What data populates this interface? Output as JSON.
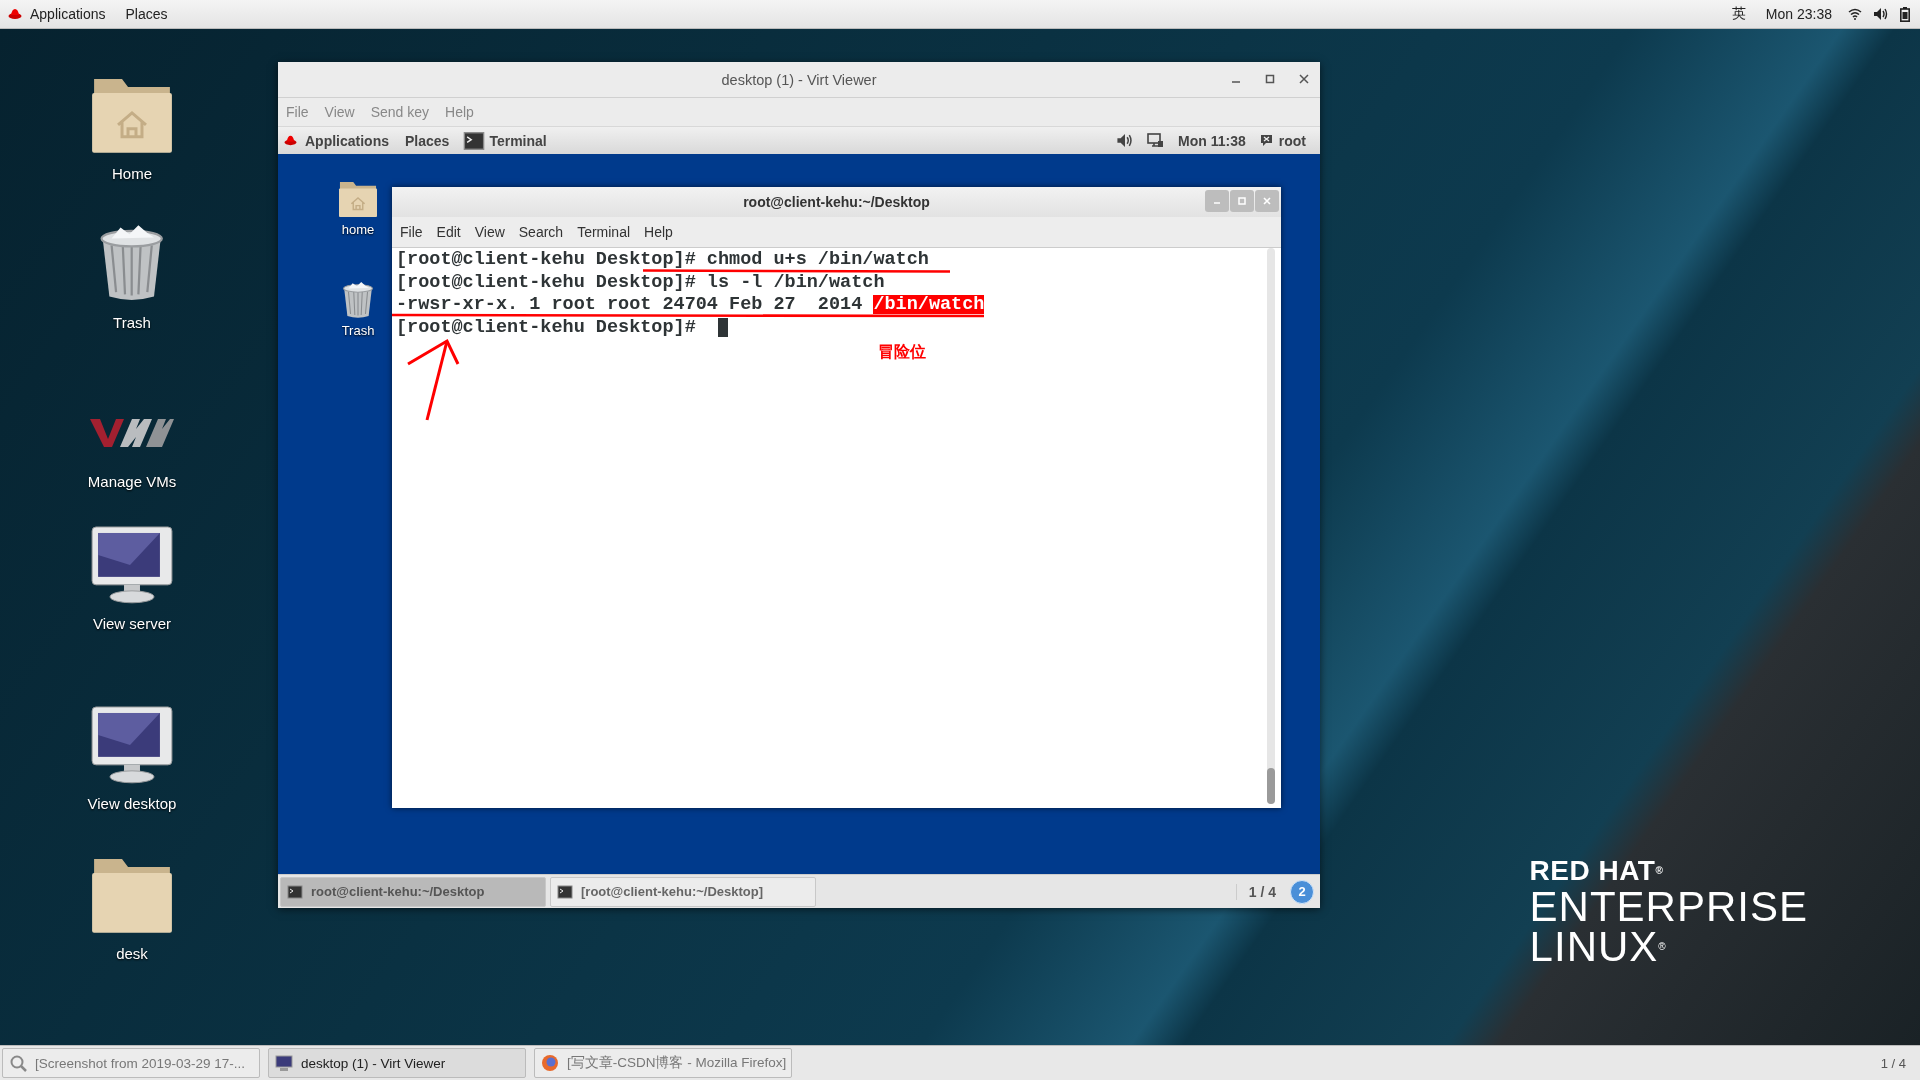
{
  "top_bar": {
    "menus": [
      "Applications",
      "Places"
    ],
    "input_method": "英",
    "clock": "Mon 23:38"
  },
  "desktop_icons": [
    {
      "label": "Home",
      "kind": "home-folder"
    },
    {
      "label": "Trash",
      "kind": "trash"
    },
    {
      "label": "Manage VMs",
      "kind": "vm"
    },
    {
      "label": "View server",
      "kind": "monitor"
    },
    {
      "label": "View desktop",
      "kind": "monitor"
    },
    {
      "label": "desk",
      "kind": "folder"
    }
  ],
  "virt_viewer": {
    "title": "desktop (1) - Virt Viewer",
    "menu": [
      "File",
      "View",
      "Send key",
      "Help"
    ],
    "guest": {
      "top_bar": {
        "menus": [
          "Applications",
          "Places"
        ],
        "active_app": "Terminal",
        "clock": "Mon 11:38",
        "user": "root"
      },
      "desktop_icons": [
        {
          "label": "home",
          "kind": "home-folder"
        },
        {
          "label": "Trash",
          "kind": "trash"
        }
      ],
      "terminal": {
        "title": "root@client-kehu:~/Desktop",
        "menu": [
          "File",
          "Edit",
          "View",
          "Search",
          "Terminal",
          "Help"
        ],
        "lines": [
          [
            {
              "text": "[root@client-kehu Desktop]# chmod u+s /bin/watch",
              "highlighted": false
            }
          ],
          [
            {
              "text": "[root@client-kehu Desktop]# ls -l /bin/watch",
              "highlighted": false
            }
          ],
          [
            {
              "text": "-rwsr-xr-x. 1 root root 24704 Feb 27  2014 ",
              "highlighted": false
            },
            {
              "text": "/bin/watch",
              "highlighted": true
            }
          ],
          [
            {
              "text": "[root@client-kehu Desktop]# ",
              "highlighted": false
            }
          ]
        ],
        "cursor": true,
        "annotation": "冒险位"
      },
      "taskbar": {
        "items": [
          {
            "label": "root@client-kehu:~/Desktop",
            "selected": true
          },
          {
            "label": "[root@client-kehu:~/Desktop]",
            "selected": false
          }
        ],
        "workspace": "1 / 4",
        "badge": "2"
      }
    }
  },
  "wallpaper_brand": {
    "line_1": "RED HAT$^{®}$",
    "line_2": "ENTERPRISE",
    "line_3": "LINUX$^{®}$"
  },
  "taskbar": {
    "items": [
      {
        "label": "[Screenshot from 2019-03-29 17-...",
        "kind": "viewer",
        "selected": false
      },
      {
        "label": "desktop (1) - Virt Viewer",
        "kind": "monitor",
        "selected": true
      },
      {
        "label": "[写文章-CSDN博客 - Mozilla Firefox]",
        "kind": "browser",
        "selected": false
      }
    ],
    "workspace": "1 / 4"
  }
}
